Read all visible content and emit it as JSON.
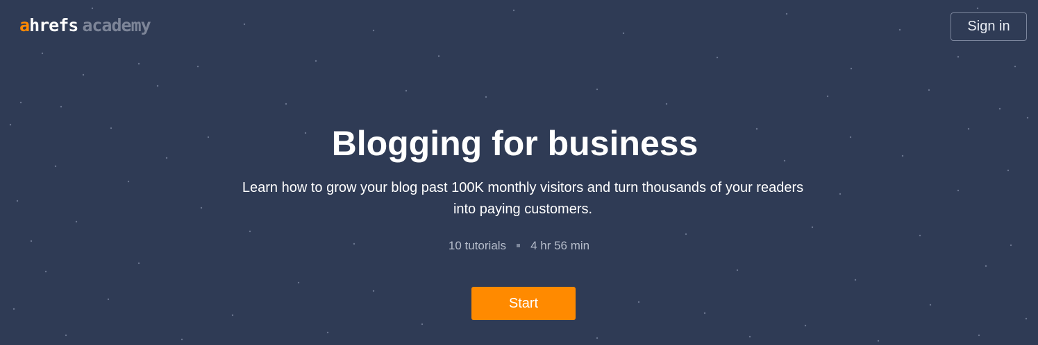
{
  "logo": {
    "a": "a",
    "hrefs": "hrefs",
    "academy": "academy",
    "colors": {
      "a": "#ff8800",
      "hrefs": "#ffffff",
      "academy": "#7d8598"
    }
  },
  "header": {
    "signin_label": "Sign in"
  },
  "hero": {
    "title": "Blogging for business",
    "description": "Learn how to grow your blog past 100K monthly visitors and turn thousands of your readers into paying customers.",
    "tutorials": "10 tutorials",
    "duration": "4 hr 56 min",
    "start_label": "Start"
  },
  "colors": {
    "background": "#2f3b55",
    "accent": "#ff8a00"
  }
}
